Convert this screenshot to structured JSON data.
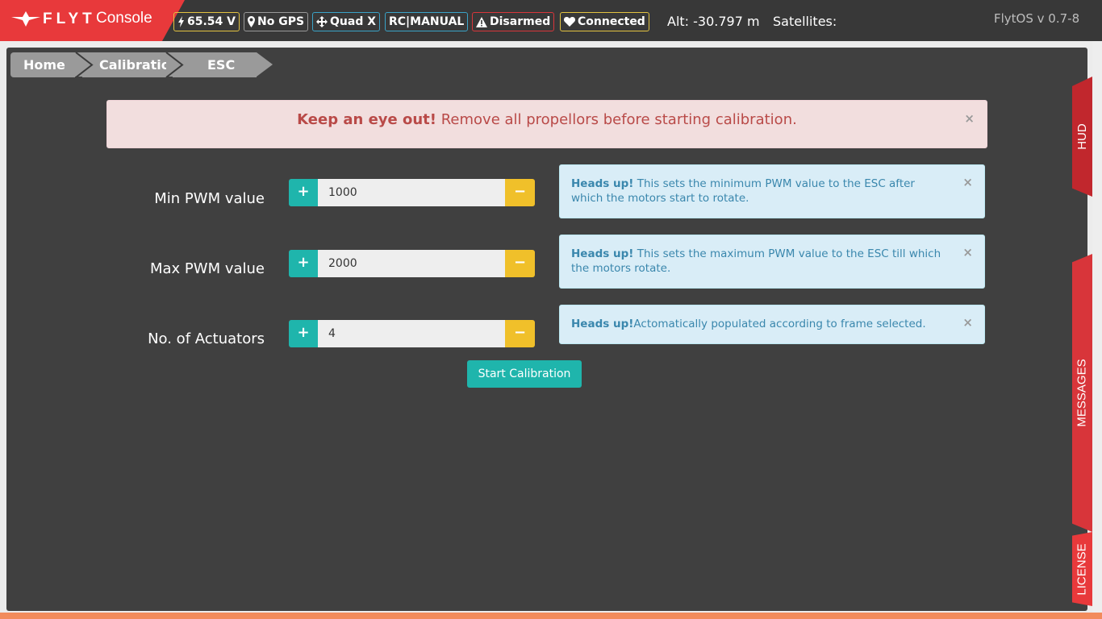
{
  "brand": {
    "name_bold": "FLYT",
    "name_light": "Console",
    "logo_icon": "flyt-logo-icon"
  },
  "status": {
    "voltage": "65.54 V",
    "gps": "No GPS",
    "frame": "Quad X",
    "mode": "RC|MANUAL",
    "arm_state": "Disarmed",
    "link": "Connected",
    "altitude": "Alt: -30.797 m",
    "satellites": "Satellites:",
    "version": "FlytOS v 0.7-8"
  },
  "breadcrumb": [
    "Home",
    "Calibratio",
    "ESC"
  ],
  "warning": {
    "title": "Keep an eye out!",
    "text": " Remove all propellors before starting calibration.",
    "close": "×"
  },
  "rows": [
    {
      "label": "Min PWM value",
      "value": "1000",
      "plus": "+",
      "minus": "−",
      "info_title": "Heads up!",
      "info_text": " This sets the minimum PWM value to the ESC after which the motors start to rotate.",
      "close": "×"
    },
    {
      "label": "Max PWM value",
      "value": "2000",
      "plus": "+",
      "minus": "−",
      "info_title": "Heads up!",
      "info_text": " This sets the maximum PWM value to the ESC till which the motors rotate.",
      "close": "×"
    },
    {
      "label": "No. of Actuators",
      "value": "4",
      "plus": "+",
      "minus": "−",
      "info_title": "Heads up!",
      "info_text": "Actomatically populated according to frame selected.",
      "close": "×"
    }
  ],
  "start_button": "Start Calibration",
  "side_tabs": [
    "HUD",
    "MESSAGES",
    "LICENSE"
  ],
  "colors": {
    "brand_red": "#e8393b",
    "panel": "#404040",
    "teal": "#1fb5ac",
    "yellow": "#f0c02a",
    "warning_text": "#b94a48",
    "info_text": "#3a87ad"
  }
}
